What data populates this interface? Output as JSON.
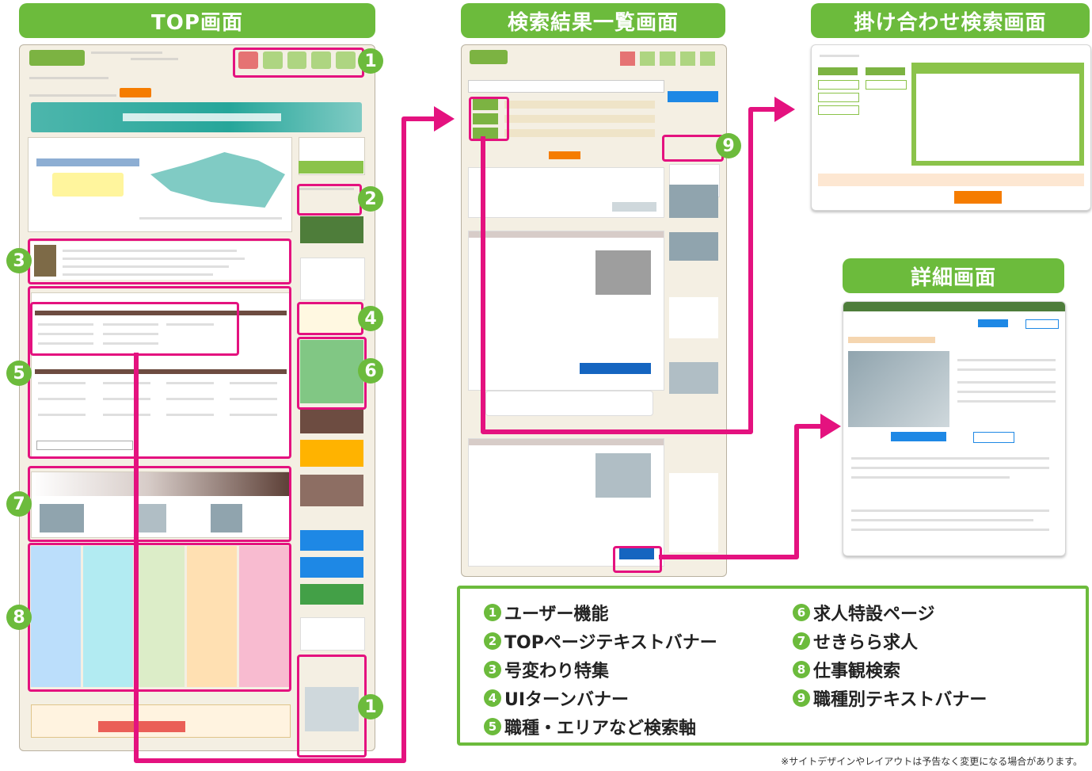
{
  "headers": {
    "top": "TOP画面",
    "search": "検索結果一覧画面",
    "combo": "掛け合わせ検索画面",
    "detail": "詳細画面"
  },
  "markers": [
    "1",
    "2",
    "3",
    "4",
    "5",
    "6",
    "7",
    "8",
    "9"
  ],
  "legend": {
    "items": [
      {
        "num": "1",
        "label": "ユーザー機能"
      },
      {
        "num": "2",
        "label": "TOPページテキストバナー"
      },
      {
        "num": "3",
        "label": "号変わり特集"
      },
      {
        "num": "4",
        "label": "UIターンバナー"
      },
      {
        "num": "5",
        "label": "職種・エリアなど検索軸"
      },
      {
        "num": "6",
        "label": "求人特設ページ"
      },
      {
        "num": "7",
        "label": "せきらら求人"
      },
      {
        "num": "8",
        "label": "仕事観検索"
      },
      {
        "num": "9",
        "label": "職種別テキストバナー"
      }
    ]
  },
  "footnote": "※サイトデザインやレイアウトは予告なく変更になる場合があります。",
  "colors": {
    "accent": "#6cbb3c",
    "pink": "#e4127f",
    "frame": "#f4efe3"
  }
}
